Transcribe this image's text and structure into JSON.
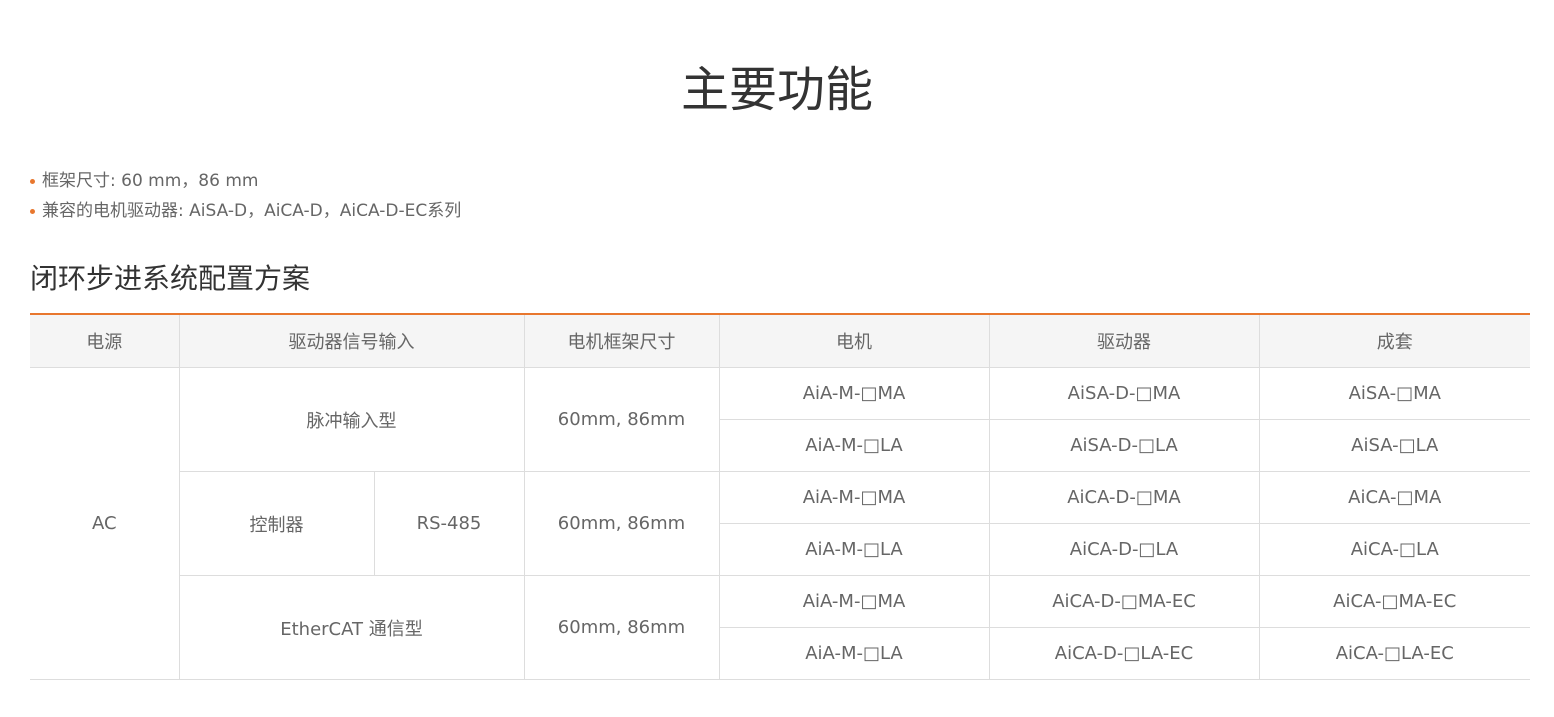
{
  "header": {
    "title": "主要功能"
  },
  "features": [
    "框架尺寸: 60 mm，86 mm",
    "兼容的电机驱动器: AiSA-D，AiCA-D，AiCA-D-EC系列"
  ],
  "section": {
    "title": "闭环步进系统配置方案"
  },
  "table": {
    "headers": {
      "power": "电源",
      "signal_input": "驱动器信号输入",
      "frame_size": "电机框架尺寸",
      "motor": "电机",
      "driver": "驱动器",
      "kit": "成套"
    },
    "power_value": "AC",
    "groups": [
      {
        "input": "脉冲输入型",
        "frame": "60mm, 86mm",
        "rows": [
          {
            "motor": "AiA-M-□MA",
            "driver": "AiSA-D-□MA",
            "kit": "AiSA-□MA"
          },
          {
            "motor": "AiA-M-□LA",
            "driver": "AiSA-D-□LA",
            "kit": "AiSA-□LA"
          }
        ]
      },
      {
        "input": "控制器",
        "input_sub": "RS-485",
        "frame": "60mm, 86mm",
        "rows": [
          {
            "motor": "AiA-M-□MA",
            "driver": "AiCA-D-□MA",
            "kit": "AiCA-□MA"
          },
          {
            "motor": "AiA-M-□LA",
            "driver": "AiCA-D-□LA",
            "kit": "AiCA-□LA"
          }
        ]
      },
      {
        "input": "EtherCAT 通信型",
        "frame": "60mm, 86mm",
        "rows": [
          {
            "motor": "AiA-M-□MA",
            "driver": "AiCA-D-□MA-EC",
            "kit": "AiCA-□MA-EC"
          },
          {
            "motor": "AiA-M-□LA",
            "driver": "AiCA-D-□LA-EC",
            "kit": "AiCA-□LA-EC"
          }
        ]
      }
    ]
  },
  "colors": {
    "accent": "#e8772e",
    "header_bg": "#f5f5f5",
    "border": "#dddddd",
    "title_text": "#333333",
    "body_text": "#666666"
  }
}
